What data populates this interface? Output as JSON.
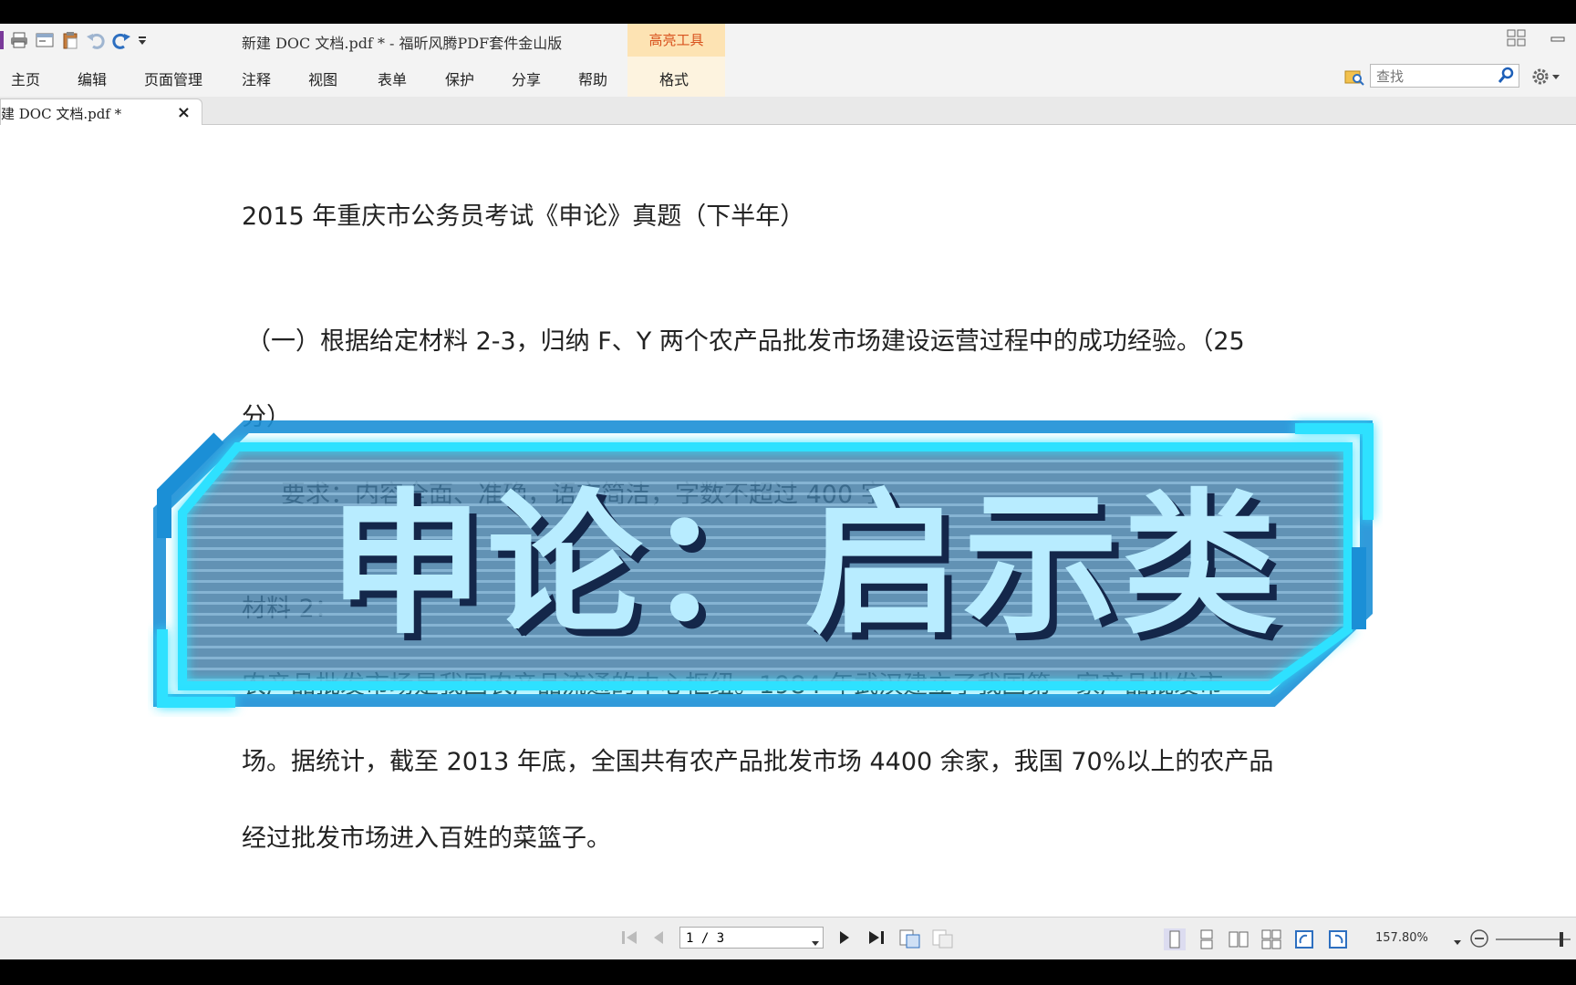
{
  "app": {
    "window_title": "新建 DOC 文档.pdf * - 福昕风腾PDF套件金山版",
    "context_tab": "高亮工具",
    "context_subtab": "格式"
  },
  "menu": [
    "主页",
    "编辑",
    "页面管理",
    "注释",
    "视图",
    "表单",
    "保护",
    "分享",
    "帮助"
  ],
  "search": {
    "placeholder": "查找"
  },
  "tab": {
    "label": "建 DOC 文档.pdf *",
    "close": "×"
  },
  "document": {
    "title": "2015 年重庆市公务员考试《申论》真题（下半年）",
    "q1_line1": "（一）根据给定材料 2-3，归纳 F、Y 两个农产品批发市场建设运营过程中的成功经验。（25",
    "q1_line2": "分）",
    "requirement": "要求：内容全面、准确，语言简洁，字数不超过 400 字。",
    "material_heading": "材料 2：",
    "para_line1": "农产品批发市场是我国农产品流通的中心枢纽。1984 年武汉建立了我国第一家产品批发市",
    "para_line2": "场。据统计，截至 2013 年底，全国共有农产品批发市场 4400 余家，我国 70%以上的农产品",
    "para_line3": "经过批发市场进入百姓的菜篮子。"
  },
  "overlay": {
    "text": "申论：启示类"
  },
  "status": {
    "page": "1 / 3",
    "zoom": "157.80%"
  }
}
